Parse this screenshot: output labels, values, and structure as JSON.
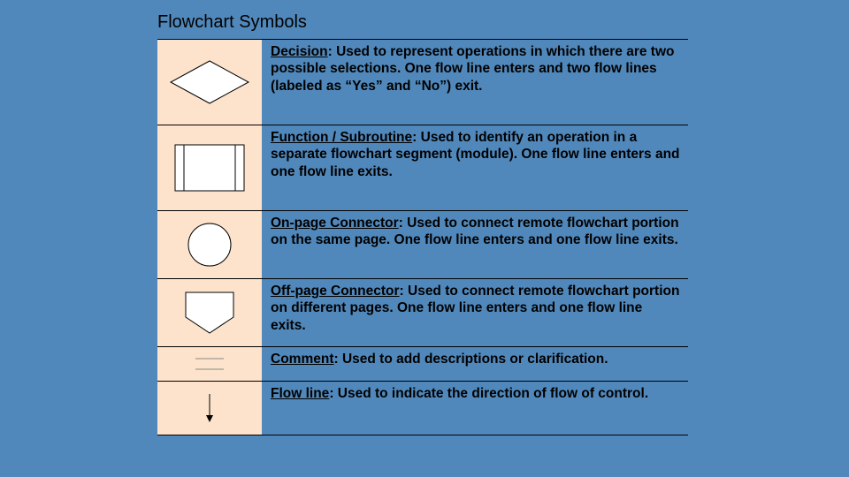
{
  "title": "Flowchart Symbols",
  "rows": [
    {
      "term": "Decision",
      "desc": ": Used to represent operations in which there are two possible selections. One flow line enters and two flow lines (labeled as “Yes” and “No”) exit."
    },
    {
      "term": "Function / Subroutine",
      "desc": ": Used to identify an operation in a separate flowchart segment (module). One flow line enters and one flow line exits."
    },
    {
      "term": "On-page Connector",
      "desc": ": Used to connect remote flowchart portion on the same page. One flow line enters and one flow line exits."
    },
    {
      "term": "Off-page Connector",
      "desc": ": Used to connect remote flowchart portion on different pages.  One flow line enters and one flow line exits."
    },
    {
      "term": "Comment",
      "desc": ": Used to add descriptions or clarification."
    },
    {
      "term": "Flow line",
      "desc": ": Used to indicate the direction of flow of control."
    }
  ]
}
